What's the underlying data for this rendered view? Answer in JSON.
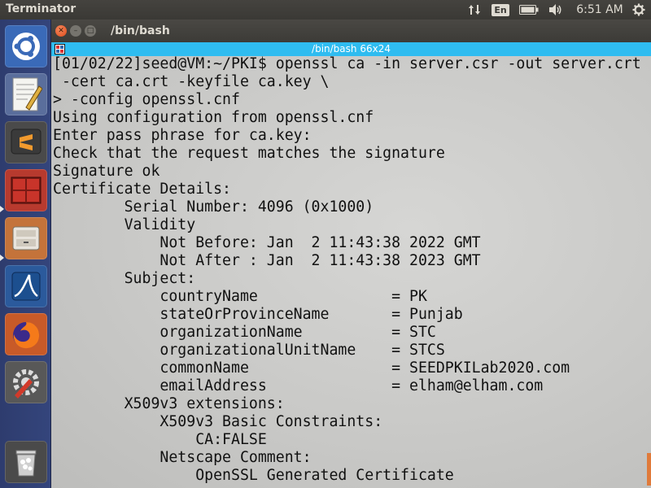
{
  "top_panel": {
    "app_title": "Terminator",
    "keyboard_layout": "En",
    "clock": "6:51 AM",
    "icons": [
      "sort-arrows-icon",
      "keyboard-icon",
      "battery-icon",
      "volume-icon",
      "gear-icon"
    ]
  },
  "launcher": {
    "items": [
      {
        "name": "ubuntu-dash-icon"
      },
      {
        "name": "text-editor-icon"
      },
      {
        "name": "sublime-text-icon"
      },
      {
        "name": "terminator-icon"
      },
      {
        "name": "file-manager-icon"
      },
      {
        "name": "wireshark-icon"
      },
      {
        "name": "firefox-icon"
      },
      {
        "name": "system-settings-icon"
      },
      {
        "name": "trash-icon"
      }
    ]
  },
  "window": {
    "title": "/bin/bash",
    "tab_title": "/bin/bash 66x24",
    "colors": {
      "tab_bar": "#2fbcf0",
      "close_button": "#e9572b",
      "terminal_bg": "#cfcfcf"
    }
  },
  "terminal": {
    "lines": [
      "[01/02/22]seed@VM:~/PKI$ openssl ca -in server.csr -out server.crt",
      " -cert ca.crt -keyfile ca.key \\",
      "> -config openssl.cnf",
      "Using configuration from openssl.cnf",
      "Enter pass phrase for ca.key:",
      "Check that the request matches the signature",
      "Signature ok",
      "Certificate Details:",
      "        Serial Number: 4096 (0x1000)",
      "        Validity",
      "            Not Before: Jan  2 11:43:38 2022 GMT",
      "            Not After : Jan  2 11:43:38 2023 GMT",
      "        Subject:",
      "            countryName               = PK",
      "            stateOrProvinceName       = Punjab",
      "            organizationName          = STC",
      "            organizationalUnitName    = STCS",
      "            commonName                = SEEDPKILab2020.com",
      "            emailAddress              = elham@elham.com",
      "        X509v3 extensions:",
      "            X509v3 Basic Constraints:",
      "                CA:FALSE",
      "            Netscape Comment:",
      "                OpenSSL Generated Certificate"
    ]
  }
}
